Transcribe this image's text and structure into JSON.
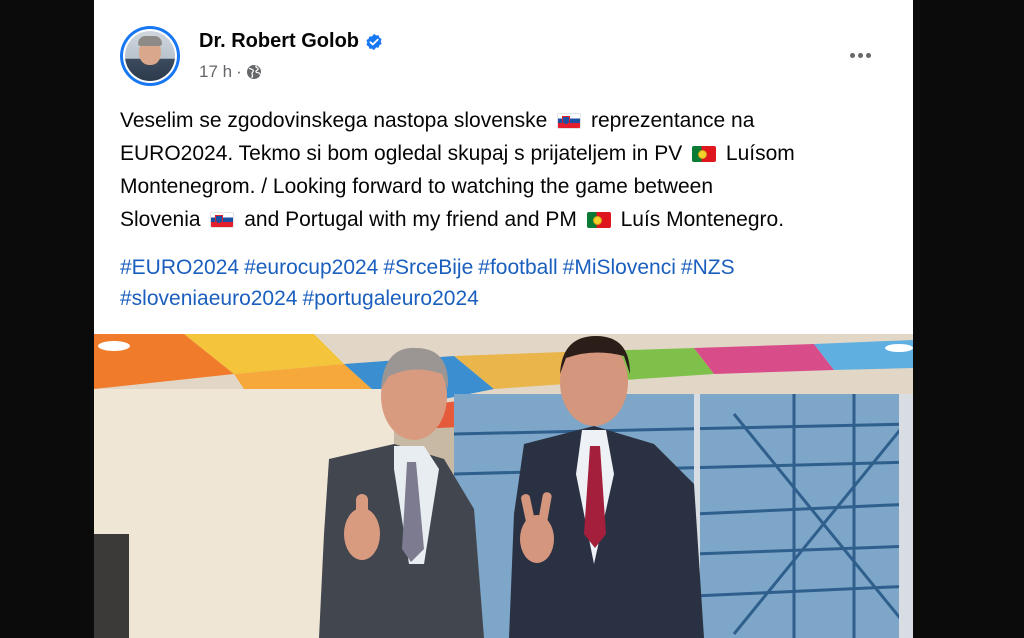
{
  "post": {
    "author": "Dr. Robert Golob",
    "timestamp": "17 h",
    "separator": "·",
    "text": {
      "line1_a": "Veselim se zgodovinskega nastopa slovenske",
      "line1_b": "reprezentance na",
      "line2_a": "EURO2024. Tekmo si bom ogledal skupaj s prijateljem in PV",
      "line2_b": "Luísom",
      "line3": "Montenegrom. / Looking forward to watching the game between",
      "line4_a": "Slovenia",
      "line4_b": "and Portugal with my friend and PM",
      "line4_c": "Luís Montenegro."
    },
    "hashtags": [
      "#EURO2024",
      "#eurocup2024",
      "#SrceBije",
      "#football",
      "#MiSlovenci",
      "#NZS",
      "#sloveniaeuro2024",
      "#portugaleuro2024"
    ],
    "flags": [
      "slovenia-flag",
      "portugal-flag"
    ],
    "icons": [
      "verified-badge-icon",
      "globe-icon",
      "more-options-icon"
    ]
  },
  "colors": {
    "link": "#1b5fbe",
    "verified": "#1877f2",
    "secondary_text": "#65676b",
    "page_background": "#0b0b0b"
  }
}
